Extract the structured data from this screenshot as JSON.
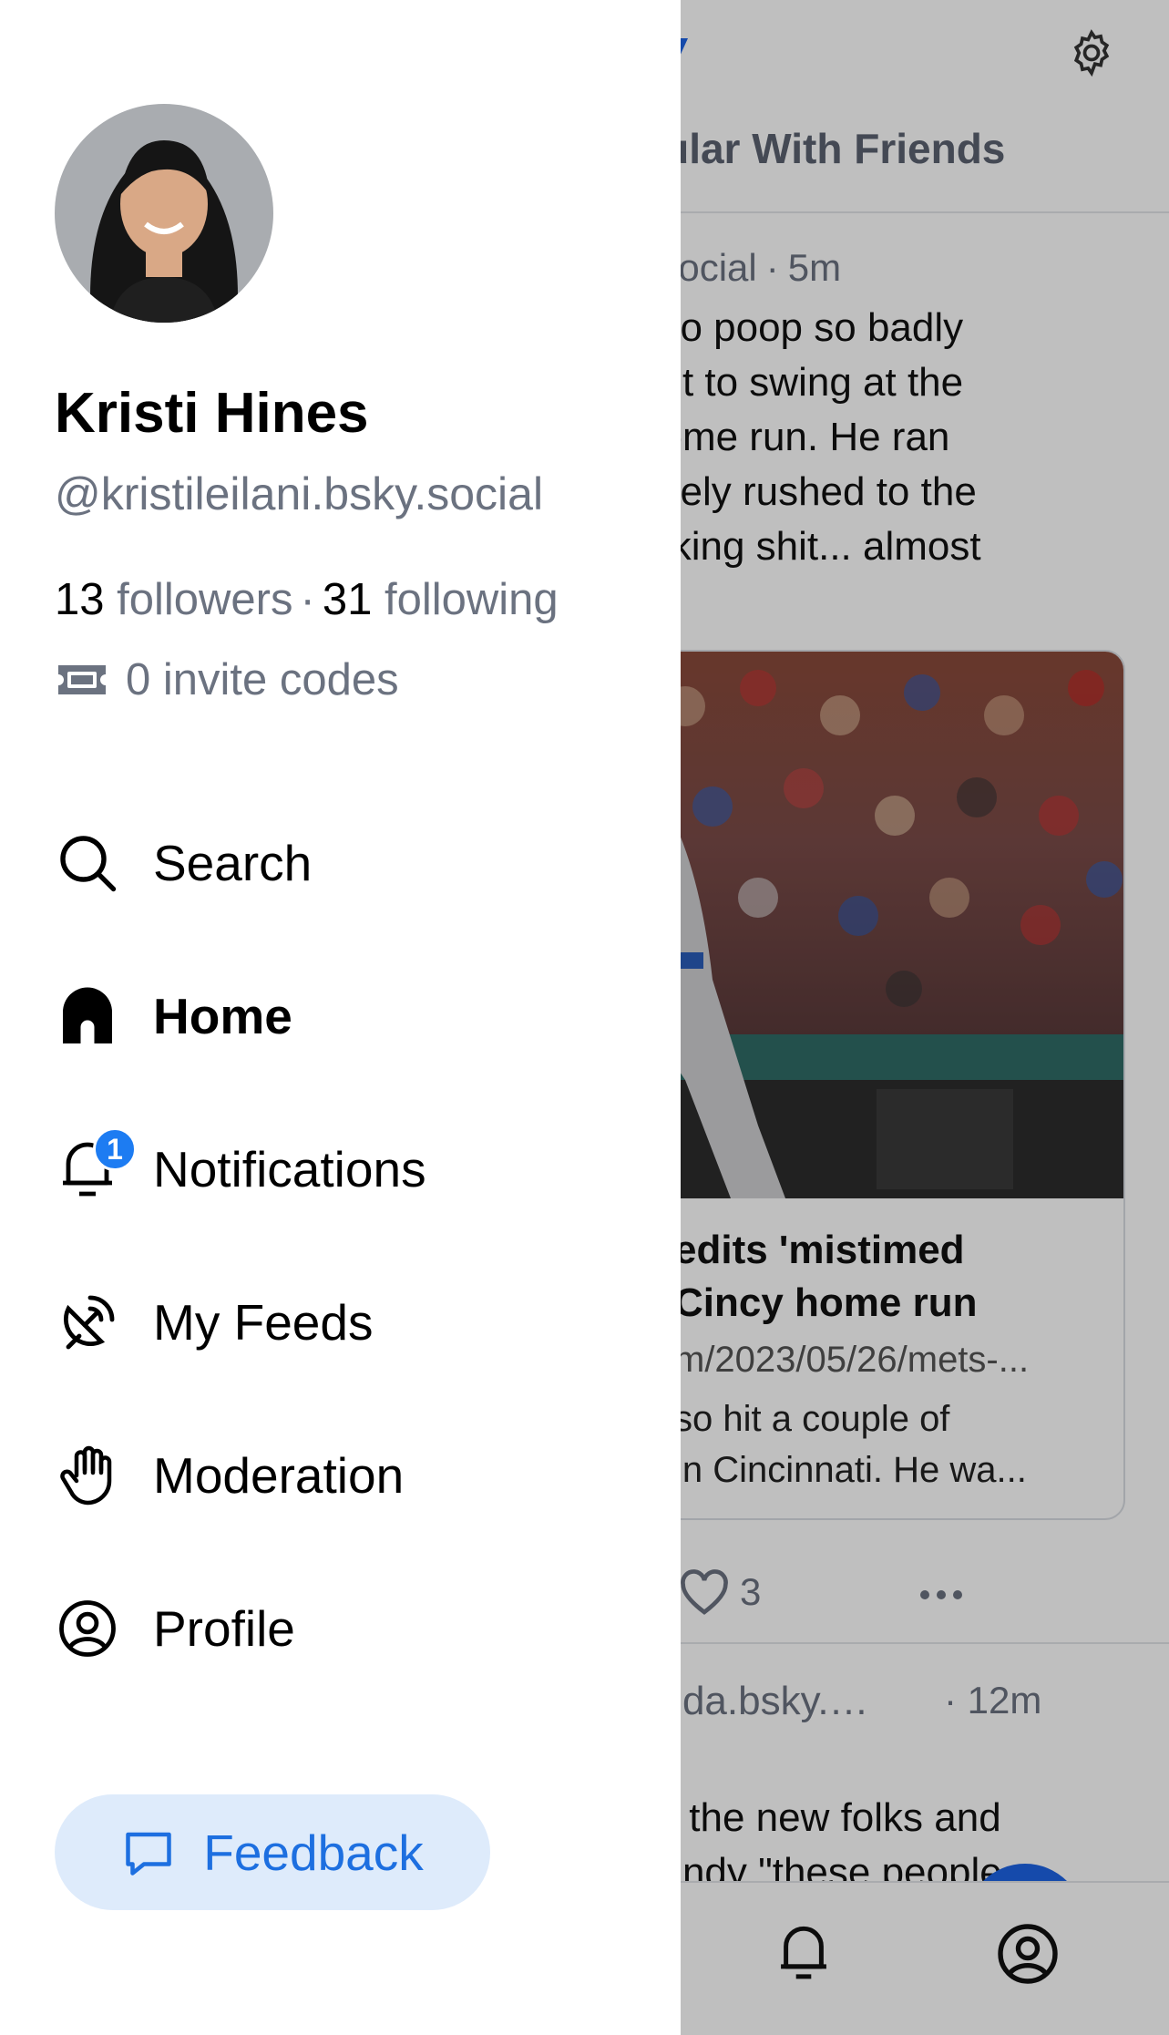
{
  "feed": {
    "tab_label": "pular With Friends",
    "post1": {
      "handle_fragment": "/.social",
      "time": "5m",
      "lines": [
        "s to poop so badly",
        "out to swing at the",
        "home run. He ran",
        "iately rushed to the",
        "e king shit... almost"
      ]
    },
    "embed": {
      "title_lines": [
        "edits 'mistimed",
        "Cincy home run"
      ],
      "url": "m/2023/05/26/mets-...",
      "desc_lines": [
        "so hit a couple of",
        "in Cincinnati. He wa..."
      ]
    },
    "like_count": "3",
    "post2": {
      "handle_fragment": "anda.bsky.…",
      "time": "12m",
      "lines": [
        "all the new folks and",
        "handy \"these people"
      ]
    }
  },
  "profile": {
    "display_name": "Kristi Hines",
    "handle": "@kristileilani.bsky.social",
    "followers_count": "13",
    "followers_label": "followers",
    "following_count": "31",
    "following_label": "following",
    "invite_codes": "0 invite codes"
  },
  "nav": {
    "search": "Search",
    "home": "Home",
    "notifications": "Notifications",
    "notifications_badge": "1",
    "my_feeds": "My Feeds",
    "moderation": "Moderation",
    "profile": "Profile"
  },
  "feedback": {
    "label": "Feedback"
  },
  "colors": {
    "accent": "#1d6fe0",
    "badge": "#1d7cf2",
    "feedback_bg": "#deebfb",
    "muted_text": "#6b7280"
  },
  "icons": {
    "search": "search-icon",
    "home": "home-icon",
    "notifications": "bell-icon",
    "my_feeds": "satellite-icon",
    "moderation": "hand-icon",
    "profile": "user-circle-icon",
    "invite": "ticket-icon",
    "feedback": "message-icon",
    "settings": "gear-icon"
  }
}
